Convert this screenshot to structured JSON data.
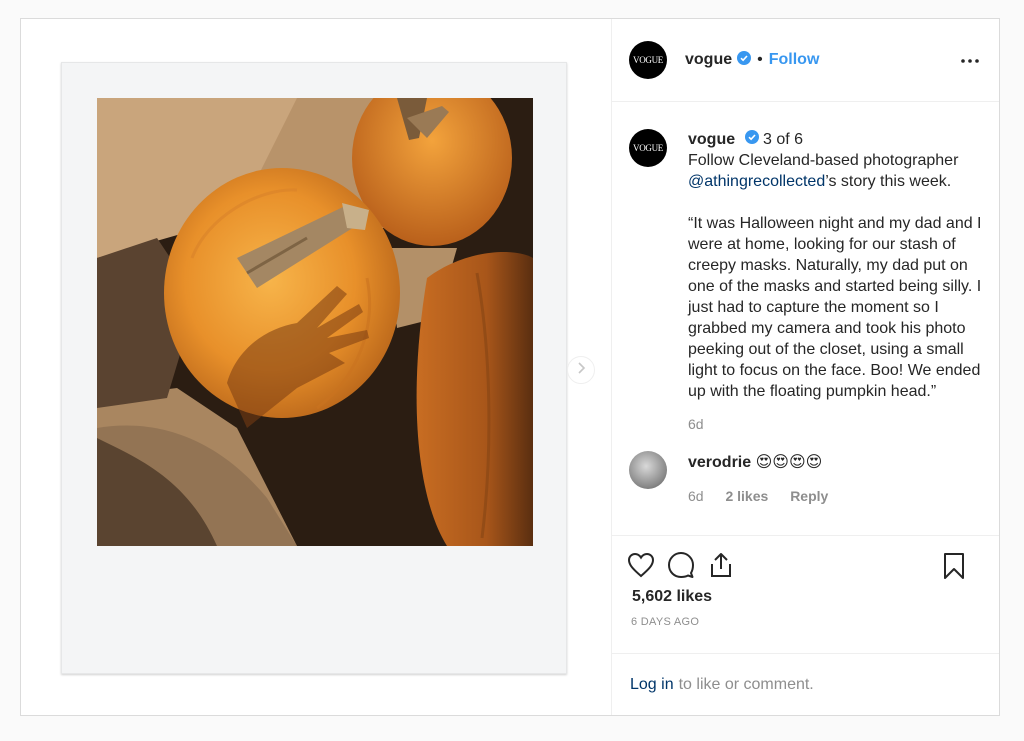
{
  "account": {
    "avatar_text": "VOGUE",
    "username": "vogue",
    "follow_label": "Follow",
    "separator": "•"
  },
  "caption": {
    "username": "vogue",
    "counter": "3 of 6",
    "line1": "Follow Cleveland-based photographer ",
    "mention": "@athingrecollected",
    "line1_tail": "’s story this week.",
    "body": "“It was Halloween night and my dad and I were at home, looking for our stash of creepy masks. Naturally, my dad put on one of the masks and started being silly. I just had to capture the moment so I grabbed my camera and took his photo peeking out of the closet, using a small light to focus on the face. Boo! We ended up with the floating pumpkin head.”",
    "time": "6d"
  },
  "reply": {
    "username": "verodrie",
    "text": "😍😍😍😍",
    "time": "6d",
    "likes": "2 likes",
    "reply_label": "Reply"
  },
  "stats": {
    "likes": "5,602 likes",
    "posted": "6 DAYS AGO"
  },
  "login": {
    "link": "Log in",
    "text": "to like or comment."
  },
  "icons": {
    "like": "heart-icon",
    "comment": "comment-icon",
    "share": "share-icon",
    "save": "bookmark-icon",
    "more": "more-options-icon",
    "next": "chevron-right-icon",
    "verified": "verified-badge-icon"
  },
  "colors": {
    "link_blue": "#3897f0",
    "mention": "#003569",
    "muted": "#8e8e8e",
    "text": "#262626"
  }
}
